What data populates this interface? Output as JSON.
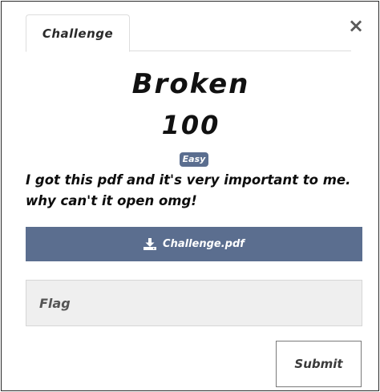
{
  "modal": {
    "tab_label": "Challenge",
    "close_label": "×"
  },
  "challenge": {
    "name": "Broken",
    "value": "100",
    "difficulty": "Easy",
    "description_line1": "I got this pdf and it's very important to me.",
    "description_line2": "why can't it open omg!",
    "file_label": "Challenge.pdf"
  },
  "form": {
    "flag_placeholder": "Flag",
    "submit_label": "Submit"
  }
}
